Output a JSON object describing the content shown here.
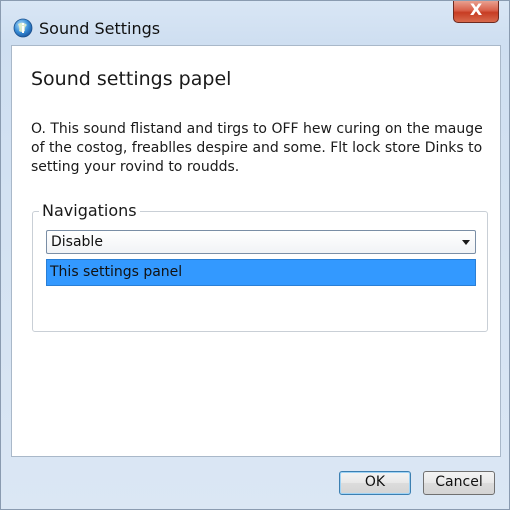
{
  "window": {
    "title": "Sound Settings",
    "close_label": "X"
  },
  "panel": {
    "heading": "Sound settings papel",
    "description": "O. This sound flistand and tirgs to OFF hew curing on the mauge of the costog, freablles despire and some. Flt lock store Dinks to setting your rovind to roudds."
  },
  "navigations": {
    "label": "Navigations",
    "select_value": "Disable",
    "selected_item": "This settings panel"
  },
  "buttons": {
    "ok": "OK",
    "cancel": "Cancel"
  },
  "colors": {
    "selection": "#3399ff",
    "close_button": "#c73c23",
    "titlebar": "#d9e6f5"
  },
  "icons": {
    "title": "info-globe-icon",
    "dropdown": "chevron-down-icon",
    "close": "close-icon"
  }
}
